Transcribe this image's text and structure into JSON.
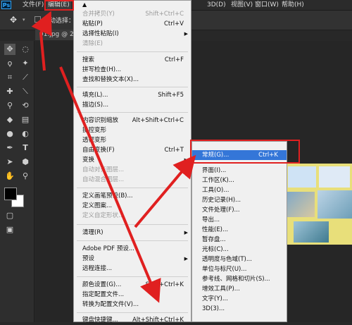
{
  "app": {
    "logo": "Ps"
  },
  "menubar": {
    "items": [
      {
        "label": "文件(F)"
      },
      {
        "label": "编辑(E)"
      },
      {
        "label": "3D(D)"
      },
      {
        "label": "视图(V)"
      },
      {
        "label": "窗口(W)"
      },
      {
        "label": "帮助(H)"
      }
    ]
  },
  "options_bar": {
    "auto_select_label": "自动选择："
  },
  "document": {
    "tab_label": "01.jpg @ 2"
  },
  "edit_menu": {
    "items": [
      {
        "label": "合并拷贝(Y)",
        "shortcut": "Shift+Ctrl+C",
        "disabled": true
      },
      {
        "label": "粘贴(P)",
        "shortcut": "Ctrl+V"
      },
      {
        "label": "选择性粘贴(I)",
        "shortcut": ""
      },
      {
        "label": "清除(E)",
        "shortcut": "",
        "disabled": true
      },
      {
        "label": "搜索",
        "shortcut": "Ctrl+F"
      },
      {
        "label": "拼写检查(H)...",
        "shortcut": ""
      },
      {
        "label": "查找和替换文本(X)...",
        "shortcut": ""
      },
      {
        "label": "填充(L)...",
        "shortcut": "Shift+F5"
      },
      {
        "label": "描边(S)...",
        "shortcut": ""
      },
      {
        "label": "内容识别缩放",
        "shortcut": "Alt+Shift+Ctrl+C"
      },
      {
        "label": "操控变形",
        "shortcut": ""
      },
      {
        "label": "透视变形",
        "shortcut": ""
      },
      {
        "label": "自由变换(F)",
        "shortcut": "Ctrl+T"
      },
      {
        "label": "变换",
        "shortcut": ""
      },
      {
        "label": "自动对齐图层...",
        "shortcut": "",
        "disabled": true
      },
      {
        "label": "自动混合图层...",
        "shortcut": "",
        "disabled": true
      },
      {
        "label": "定义画笔预设(B)...",
        "shortcut": ""
      },
      {
        "label": "定义图案...",
        "shortcut": ""
      },
      {
        "label": "定义自定形状...",
        "shortcut": "",
        "disabled": true
      },
      {
        "label": "清理(R)",
        "shortcut": ""
      },
      {
        "label": "Adobe PDF 预设...",
        "shortcut": ""
      },
      {
        "label": "预设",
        "shortcut": ""
      },
      {
        "label": "远程连接...",
        "shortcut": ""
      },
      {
        "label": "颜色设置(G)...",
        "shortcut": "Shift+Ctrl+K"
      },
      {
        "label": "指定配置文件...",
        "shortcut": ""
      },
      {
        "label": "转换为配置文件(V)...",
        "shortcut": ""
      },
      {
        "label": "键盘快捷键...",
        "shortcut": "Alt+Shift+Ctrl+K"
      }
    ]
  },
  "preferences_submenu": {
    "items": [
      {
        "label": "常规(G)...",
        "shortcut": "Ctrl+K",
        "highlighted": true
      },
      {
        "label": "界面(I)...",
        "shortcut": ""
      },
      {
        "label": "工作区(K)...",
        "shortcut": ""
      },
      {
        "label": "工具(O)...",
        "shortcut": ""
      },
      {
        "label": "历史记录(H)...",
        "shortcut": ""
      },
      {
        "label": "文件处理(F)...",
        "shortcut": ""
      },
      {
        "label": "导出...",
        "shortcut": ""
      },
      {
        "label": "性能(E)...",
        "shortcut": ""
      },
      {
        "label": "暂存盘...",
        "shortcut": ""
      },
      {
        "label": "光标(C)...",
        "shortcut": ""
      },
      {
        "label": "透明度与色域(T)...",
        "shortcut": ""
      },
      {
        "label": "单位与标尺(U)...",
        "shortcut": ""
      },
      {
        "label": "参考线、网格和切片(S)...",
        "shortcut": ""
      },
      {
        "label": "增效工具(P)...",
        "shortcut": ""
      },
      {
        "label": "文字(Y)...",
        "shortcut": ""
      },
      {
        "label": "3D(3)...",
        "shortcut": ""
      }
    ]
  },
  "colors": {
    "annotation_red": "#e02020",
    "highlight_blue": "#3476d8"
  }
}
